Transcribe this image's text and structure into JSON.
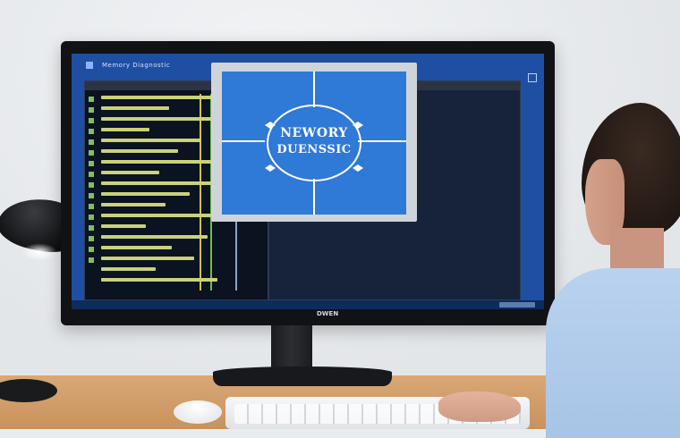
{
  "scene": {
    "os_window_title": "Memory Diagnostic",
    "diagram_text_line1": "NEWORY",
    "diagram_text_line2": "DUENSSIC",
    "monitor_brand": "DWEN",
    "colors": {
      "screen_blue": "#1f4fa3",
      "diagram_blue": "#2f79d7",
      "code_text": "#c9d27a",
      "accent_green": "#7fbf5f",
      "desk": "#d9a876"
    },
    "icons": [
      "windows-logo-icon",
      "window-control-icon",
      "compass-node-icon"
    ]
  }
}
